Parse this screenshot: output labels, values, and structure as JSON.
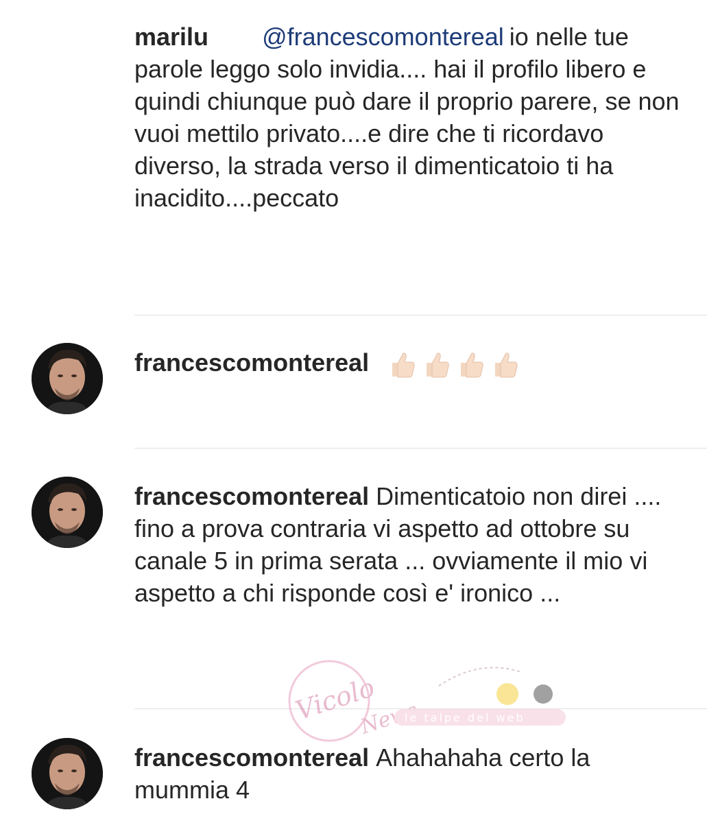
{
  "comments": [
    {
      "username": "marilu",
      "mention": "@francescomontereal",
      "text": "io nelle tue parole leggo solo invidia.... hai il profilo libero e quindi chiunque può dare il proprio parere, se non vuoi mettilo privato....e dire che ti ricordavo diverso, la strada verso il dimenticatoio ti ha inacidito....peccato"
    },
    {
      "username": "francescomontereal",
      "emoji": [
        "thumbs-up-icon",
        "thumbs-up-icon",
        "thumbs-up-icon",
        "thumbs-up-icon"
      ]
    },
    {
      "username": "francescomontereal",
      "text": "Dimenticatoio non direi .... fino a prova contraria vi aspetto ad ottobre su canale 5 in prima serata ... ovviamente il mio vi aspetto a chi risponde così e' ironico ..."
    },
    {
      "username": "francescomontereal",
      "text": "Ahahahaha certo la mummia 4"
    }
  ],
  "watermark": {
    "logo_text": "Vicolo delle News",
    "banner_text": "le talpe del web"
  },
  "colors": {
    "text": "#262626",
    "mention": "#1d3b78",
    "divider": "#e0e0e0",
    "watermark_pink": "#e8a0c0"
  }
}
